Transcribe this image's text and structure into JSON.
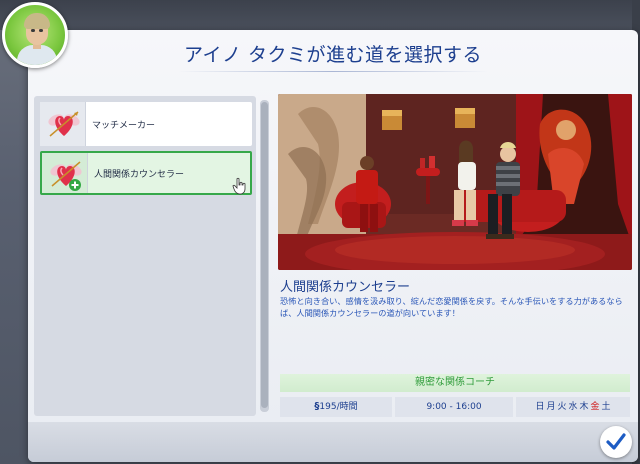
{
  "dialog": {
    "title": "アイノ タクミが進む道を選択する"
  },
  "avatar": {
    "icon": "sim-portrait-icon",
    "background_color": "#79c63d"
  },
  "career_list": [
    {
      "label": "マッチメーカー",
      "icon": "cupid-heart-icon",
      "selected": false
    },
    {
      "label": "人間関係カウンセラー",
      "icon": "cupid-heart-icon",
      "selected": true
    }
  ],
  "detail": {
    "title": "人間関係カウンセラー",
    "description": "恐怖と向き合い、感情を汲み取り、綻んだ恋愛関係を戻す。そんな手伝いをする力があるならば、人間関係カウンセラーの道が向いています！",
    "branch_title": "親密な関係コーチ",
    "pay": "195/時間",
    "hours": "9:00 - 16:00",
    "days": [
      {
        "label": "日",
        "color": "#1d3f8f"
      },
      {
        "label": "月",
        "color": "#1d3f8f"
      },
      {
        "label": "火",
        "color": "#1d3f8f"
      },
      {
        "label": "水",
        "color": "#1d3f8f"
      },
      {
        "label": "木",
        "color": "#1d3f8f"
      },
      {
        "label": "金",
        "color": "#d02020"
      },
      {
        "label": "土",
        "color": "#1d3f8f"
      }
    ]
  },
  "colors": {
    "title_blue": "#1d3f8f",
    "description_blue": "#2b57b8",
    "selected_green": "#36a84a",
    "branch_green": "#2f9c3a"
  },
  "footer": {
    "confirm_icon": "checkmark-icon"
  }
}
